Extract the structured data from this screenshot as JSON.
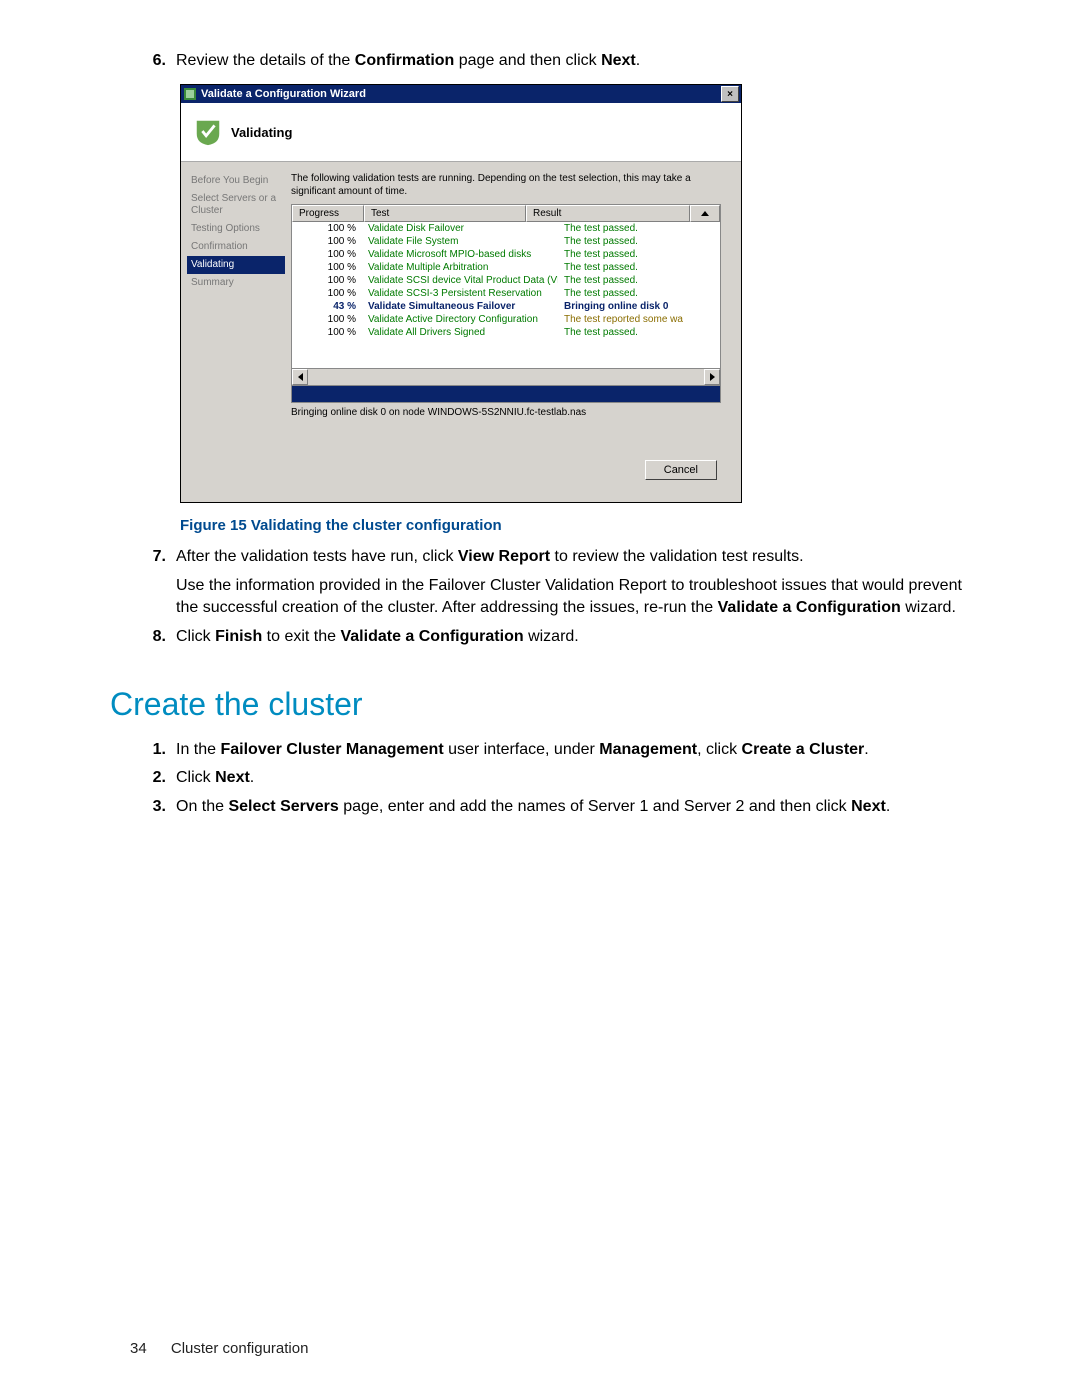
{
  "steps_a": {
    "n6": "6.",
    "t6_pre": "Review the details of the ",
    "t6_s1": "Confirmation",
    "t6_mid": " page and then click ",
    "t6_s2": "Next",
    "t6_post": "."
  },
  "wizard": {
    "title": "Validate a Configuration Wizard",
    "heading": "Validating",
    "side": {
      "before": "Before You Begin",
      "select": "Select Servers or a Cluster",
      "testing": "Testing Options",
      "confirm": "Confirmation",
      "validating": "Validating",
      "summary": "Summary"
    },
    "intro": "The following validation tests are running. Depending on the test selection, this may take a significant amount of time.",
    "cols": {
      "progress": "Progress",
      "test": "Test",
      "result": "Result"
    },
    "rows": [
      {
        "p": "100 %",
        "t": "Validate Disk Failover",
        "r": "The test passed.",
        "cls": ""
      },
      {
        "p": "100 %",
        "t": "Validate File System",
        "r": "The test passed.",
        "cls": ""
      },
      {
        "p": "100 %",
        "t": "Validate Microsoft MPIO-based disks",
        "r": "The test passed.",
        "cls": ""
      },
      {
        "p": "100 %",
        "t": "Validate Multiple Arbitration",
        "r": "The test passed.",
        "cls": ""
      },
      {
        "p": "100 %",
        "t": "Validate SCSI device Vital Product Data (VPD)",
        "r": "The test passed.",
        "cls": ""
      },
      {
        "p": "100 %",
        "t": "Validate SCSI-3 Persistent Reservation",
        "r": "The test passed.",
        "cls": ""
      },
      {
        "p": "43 %",
        "t": "Validate Simultaneous Failover",
        "r": "Bringing online disk 0",
        "cls": "running"
      },
      {
        "p": "100 %",
        "t": "Validate Active Directory Configuration",
        "r": "The test reported some wa",
        "rcls": "warn"
      },
      {
        "p": "100 %",
        "t": "Validate All Drivers Signed",
        "r": "The test passed.",
        "cls": ""
      }
    ],
    "status": "Bringing online disk 0 on node WINDOWS-5S2NNIU.fc-testlab.nas",
    "cancel": "Cancel"
  },
  "fig_caption": "Figure 15 Validating the cluster configuration",
  "steps_b": {
    "n7": "7.",
    "t7_a": "After the validation tests have run, click ",
    "t7_s1": "View Report",
    "t7_b": " to review the validation test results.",
    "t7_p2a": "Use the information provided in the Failover Cluster Validation Report to troubleshoot issues that would prevent the successful creation of the cluster. After addressing the issues, re-run the ",
    "t7_p2s": "Validate a Configuration",
    "t7_p2b": " wizard.",
    "n8": "8.",
    "t8_a": "Click ",
    "t8_s1": "Finish",
    "t8_b": " to exit the ",
    "t8_s2": "Validate a Configuration",
    "t8_c": " wizard."
  },
  "h1": "Create the cluster",
  "steps_c": {
    "n1": "1.",
    "t1_a": "In the ",
    "t1_s1": "Failover Cluster Management",
    "t1_b": " user interface, under ",
    "t1_s2": "Management",
    "t1_c": ", click ",
    "t1_s3": "Create a Cluster",
    "t1_d": ".",
    "n2": "2.",
    "t2_a": "Click ",
    "t2_s1": "Next",
    "t2_b": ".",
    "n3": "3.",
    "t3_a": "On the ",
    "t3_s1": "Select Servers",
    "t3_b": " page, enter and add the names of Server 1 and Server 2 and then click ",
    "t3_s2": "Next",
    "t3_c": "."
  },
  "footer": {
    "page": "34",
    "section": "Cluster configuration"
  }
}
